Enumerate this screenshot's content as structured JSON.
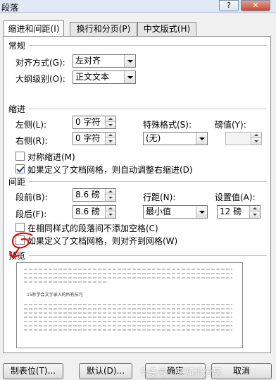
{
  "window": {
    "title": "段落",
    "help_label": "?",
    "close_label": "✕"
  },
  "tabs": [
    {
      "label": "缩进和间距(I)",
      "active": true
    },
    {
      "label": "换行和分页(P)",
      "active": false
    },
    {
      "label": "中文版式(H)",
      "active": false
    }
  ],
  "general": {
    "heading": "常规",
    "alignment_label": "对齐方式(G):",
    "alignment_value": "左对齐",
    "outline_label": "大纲级别(O):",
    "outline_value": "正文文本"
  },
  "indent": {
    "heading": "缩进",
    "left_label": "左侧(L):",
    "left_value": "0 字符",
    "right_label": "右侧(R):",
    "right_value": "0 字符",
    "special_label": "特殊格式(S):",
    "special_value": "(无)",
    "by_label": "磅值(Y):",
    "by_value": "",
    "mirror_label": "对称缩进(M)",
    "mirror_checked": false,
    "auto_adjust_label": "如果定义了文档网格，则自动调整右缩进(D)",
    "auto_adjust_checked": true
  },
  "spacing": {
    "heading": "间距",
    "before_label": "段前(B):",
    "before_value": "8.6 磅",
    "after_label": "段后(F):",
    "after_value": "8.6 磅",
    "line_label": "行距(N):",
    "line_value": "最小值",
    "at_label": "设置值(A):",
    "at_value": "12 磅",
    "no_space_label": "在相同样式的段落间不添加空格(C)",
    "no_space_checked": false,
    "snap_grid_label": "如果定义了文档网格，则对齐到网格(W)",
    "snap_grid_checked": false
  },
  "preview": {
    "heading": "预览",
    "sample_text": "15秒学会文字录入的所有技巧"
  },
  "buttons": {
    "tabs_label": "制表位(T)...",
    "default_label": "默认(D)...",
    "ok_label": "确定",
    "cancel_label": "取消"
  },
  "watermark": "头条号 / 某知识分享"
}
